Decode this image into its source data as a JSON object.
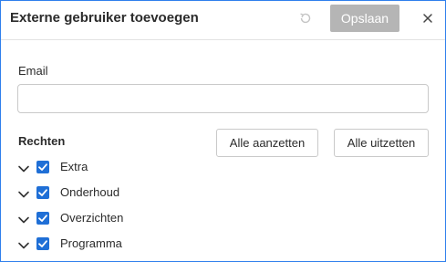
{
  "dialog": {
    "title": "Externe gebruiker toevoegen",
    "save_label": "Opslaan"
  },
  "form": {
    "email_label": "Email",
    "email_value": "",
    "email_placeholder": ""
  },
  "permissions": {
    "title": "Rechten",
    "all_on_label": "Alle aanzetten",
    "all_off_label": "Alle uitzetten",
    "items": [
      {
        "label": "Extra",
        "checked": true
      },
      {
        "label": "Onderhoud",
        "checked": true
      },
      {
        "label": "Overzichten",
        "checked": true
      },
      {
        "label": "Programma",
        "checked": true
      }
    ]
  },
  "icons": {
    "undo": "undo-icon",
    "close": "close-icon",
    "expand": "chevron-down-icon",
    "checkbox": "checkmark-icon"
  },
  "colors": {
    "accent": "#1f6fd6",
    "dialog_border": "#2f80ed",
    "save_disabled": "#b5b5b5",
    "text": "#2b2b2b"
  }
}
